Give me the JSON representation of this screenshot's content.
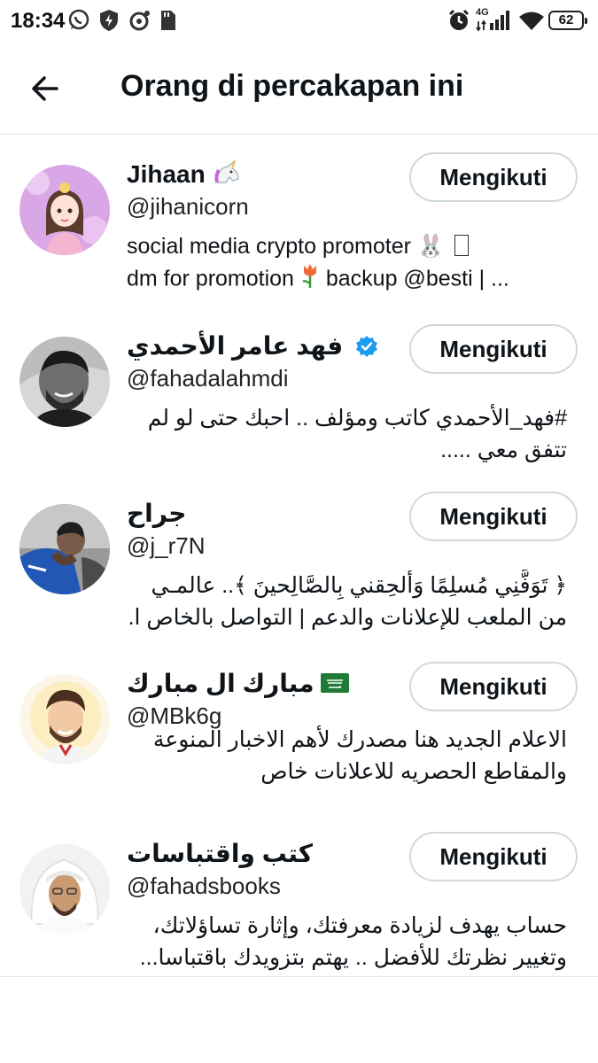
{
  "status_bar": {
    "time": "18:34",
    "network": "4G",
    "battery": "62",
    "icons": [
      "whatsapp-icon",
      "shield-icon",
      "camera-icon",
      "sd-card-icon",
      "alarm-icon",
      "signal-icon",
      "wifi-icon",
      "battery-icon"
    ]
  },
  "header": {
    "title": "Orang di percakapan ini",
    "back_icon": "arrow-left-icon"
  },
  "follow_label": "Mengikuti",
  "accent_colors": {
    "verified": "#1d9bf0",
    "border": "#cfd9de"
  },
  "users": [
    {
      "name": "Jihaan",
      "name_emoji": "unicorn-emoji",
      "handle": "@jihanicorn",
      "bio_line1": "social media crypto promoter",
      "bio_line1_suffix": "🐰",
      "bio_line2_a": "dm for promotion",
      "bio_line2_b": "backup @besti | ..."
    },
    {
      "name": "فهد عامر الأحمدي",
      "verified": true,
      "handle": "@fahadalahmdi",
      "bio_line1": "#فهد_الأحمدي كاتب ومؤلف .. احبك حتى لو لم",
      "bio_line2": "تتفق معي ....."
    },
    {
      "name": "جراح",
      "handle": "@j_r7N",
      "bio_line1": "﴿ تَوَفَّنِي مُسلِمًا وَأَلحِقني بِالصَّالِحينَ ﴾.. عالمـي",
      "bio_line2": "من الملعب للإعلانات والدعم | التواصل بالخاص ا..."
    },
    {
      "name": "مبارك ال مبارك",
      "name_emoji": "saudi-flag-emoji",
      "handle": "@MBk6g",
      "bio_line1": "الاعلام الجديد هنا مصدرك لأهم الاخبار المنوعة",
      "bio_line2": "والمقاطع الحصريه للاعلانات خاص"
    },
    {
      "name": "كتب واقتباسات",
      "handle": "@fahadsbooks",
      "bio_line1": "حساب يهدف لزيادة معرفتك، وإثارة تساؤلاتك،",
      "bio_line2": "وتغيير نظرتك للأفضل .. يهتم بتزويدك باقتباسا..."
    }
  ]
}
